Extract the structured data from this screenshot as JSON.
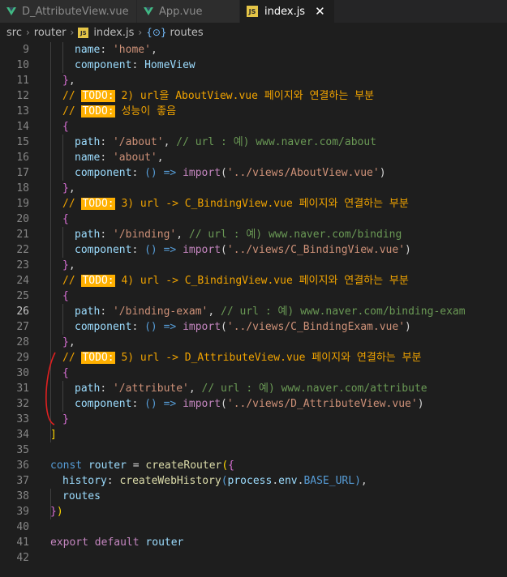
{
  "tabs": [
    {
      "label": "D_AttributeView.vue"
    },
    {
      "label": "App.vue"
    },
    {
      "label": "index.js",
      "icon_text": "JS",
      "close": "✕"
    }
  ],
  "breadcrumb": {
    "src": "src",
    "router": "router",
    "file": "index.js",
    "icon_text": "JS",
    "symbol_icon": "{⊙}",
    "symbol": "routes"
  },
  "editor": {
    "current_line": 26,
    "lines": [
      [
        [
          [
            "p",
            "name"
          ],
          [
            "w",
            ": "
          ],
          [
            "s",
            "'home'"
          ],
          [
            "w",
            ","
          ]
        ],
        2
      ],
      [
        [
          [
            "p",
            "component"
          ],
          [
            "w",
            ": "
          ],
          [
            "p",
            "HomeView"
          ]
        ],
        2
      ],
      [
        [
          [
            "pu",
            "}"
          ],
          [
            "w",
            ","
          ]
        ],
        1
      ],
      [
        [
          [
            "cm",
            "// "
          ],
          [
            "todo",
            "TODO:"
          ],
          [
            "cm",
            " 2) url을 AboutView.vue 페이지와 연결하는 부분"
          ]
        ],
        1
      ],
      [
        [
          [
            "cm",
            "// "
          ],
          [
            "todo",
            "TODO:"
          ],
          [
            "cm",
            " 성능이 좋음"
          ]
        ],
        1
      ],
      [
        [
          [
            "pu",
            "{"
          ]
        ],
        1
      ],
      [
        [
          [
            "p",
            "path"
          ],
          [
            "w",
            ": "
          ],
          [
            "s",
            "'/about'"
          ],
          [
            "w",
            ", "
          ],
          [
            "c",
            "// url : 예) www.naver.com/about"
          ]
        ],
        2
      ],
      [
        [
          [
            "p",
            "name"
          ],
          [
            "w",
            ": "
          ],
          [
            "s",
            "'about'"
          ],
          [
            "w",
            ","
          ]
        ],
        2
      ],
      [
        [
          [
            "p",
            "component"
          ],
          [
            "w",
            ": "
          ],
          [
            "k",
            "()"
          ],
          [
            "w",
            " "
          ],
          [
            "k",
            "=>"
          ],
          [
            "w",
            " "
          ],
          [
            "kw",
            "import"
          ],
          [
            "w",
            "("
          ],
          [
            "s",
            "'../views/AboutView.vue'"
          ],
          [
            "w",
            ")"
          ]
        ],
        2
      ],
      [
        [
          [
            "pu",
            "}"
          ],
          [
            "w",
            ","
          ]
        ],
        1
      ],
      [
        [
          [
            "cm",
            "// "
          ],
          [
            "todo",
            "TODO:"
          ],
          [
            "cm",
            " 3) url -> C_BindingView.vue 페이지와 연결하는 부분"
          ]
        ],
        1
      ],
      [
        [
          [
            "pu",
            "{"
          ]
        ],
        1
      ],
      [
        [
          [
            "p",
            "path"
          ],
          [
            "w",
            ": "
          ],
          [
            "s",
            "'/binding'"
          ],
          [
            "w",
            ", "
          ],
          [
            "c",
            "// url : 예) www.naver.com/binding"
          ]
        ],
        2
      ],
      [
        [
          [
            "p",
            "component"
          ],
          [
            "w",
            ": "
          ],
          [
            "k",
            "()"
          ],
          [
            "w",
            " "
          ],
          [
            "k",
            "=>"
          ],
          [
            "w",
            " "
          ],
          [
            "kw",
            "import"
          ],
          [
            "w",
            "("
          ],
          [
            "s",
            "'../views/C_BindingView.vue'"
          ],
          [
            "w",
            ")"
          ]
        ],
        2
      ],
      [
        [
          [
            "pu",
            "}"
          ],
          [
            "w",
            ","
          ]
        ],
        1
      ],
      [
        [
          [
            "cm",
            "// "
          ],
          [
            "todo",
            "TODO:"
          ],
          [
            "cm",
            " 4) url -> C_BindingView.vue 페이지와 연결하는 부분"
          ]
        ],
        1
      ],
      [
        [
          [
            "pu",
            "{"
          ]
        ],
        1
      ],
      [
        [
          [
            "p",
            "path"
          ],
          [
            "w",
            ": "
          ],
          [
            "s",
            "'/binding-exam'"
          ],
          [
            "w",
            ", "
          ],
          [
            "c",
            "// url : 예) www.naver.com/binding-exam"
          ]
        ],
        2
      ],
      [
        [
          [
            "p",
            "component"
          ],
          [
            "w",
            ": "
          ],
          [
            "k",
            "()"
          ],
          [
            "w",
            " "
          ],
          [
            "k",
            "=>"
          ],
          [
            "w",
            " "
          ],
          [
            "kw",
            "import"
          ],
          [
            "w",
            "("
          ],
          [
            "s",
            "'../views/C_BindingExam.vue'"
          ],
          [
            "w",
            ")"
          ]
        ],
        2
      ],
      [
        [
          [
            "pu",
            "}"
          ],
          [
            "w",
            ","
          ]
        ],
        1
      ],
      [
        [
          [
            "cm",
            "// "
          ],
          [
            "todo",
            "TODO:"
          ],
          [
            "cm",
            " 5) url -> D_AttributeView.vue 페이지와 연결하는 부분"
          ]
        ],
        1
      ],
      [
        [
          [
            "pu",
            "{"
          ]
        ],
        1
      ],
      [
        [
          [
            "p",
            "path"
          ],
          [
            "w",
            ": "
          ],
          [
            "s",
            "'/attribute'"
          ],
          [
            "w",
            ", "
          ],
          [
            "c",
            "// url : 예) www.naver.com/attribute"
          ]
        ],
        2
      ],
      [
        [
          [
            "p",
            "component"
          ],
          [
            "w",
            ": "
          ],
          [
            "k",
            "()"
          ],
          [
            "w",
            " "
          ],
          [
            "k",
            "=>"
          ],
          [
            "w",
            " "
          ],
          [
            "kw",
            "import"
          ],
          [
            "w",
            "("
          ],
          [
            "s",
            "'../views/D_AttributeView.vue'"
          ],
          [
            "w",
            ")"
          ]
        ],
        2
      ],
      [
        [
          [
            "pu",
            "}"
          ]
        ],
        1
      ],
      [
        [
          [
            "y",
            "]"
          ]
        ],
        0
      ],
      [
        [],
        0
      ],
      [
        [
          [
            "k",
            "const"
          ],
          [
            "w",
            " "
          ],
          [
            "p",
            "router"
          ],
          [
            "w",
            " = "
          ],
          [
            "f",
            "createRouter"
          ],
          [
            "y",
            "("
          ],
          [
            "pu",
            "{"
          ]
        ],
        0
      ],
      [
        [
          [
            "p",
            "history"
          ],
          [
            "w",
            ": "
          ],
          [
            "f",
            "createWebHistory"
          ],
          [
            "k",
            "("
          ],
          [
            "p",
            "process"
          ],
          [
            "w",
            "."
          ],
          [
            "p",
            "env"
          ],
          [
            "w",
            "."
          ],
          [
            "k",
            "BASE_URL"
          ],
          [
            "k",
            ")"
          ],
          [
            "w",
            ","
          ]
        ],
        1
      ],
      [
        [
          [
            "p",
            "routes"
          ]
        ],
        1
      ],
      [
        [
          [
            "pu",
            "}"
          ],
          [
            "y",
            ")"
          ]
        ],
        0
      ],
      [
        [],
        0
      ],
      [
        [
          [
            "kw",
            "export"
          ],
          [
            "w",
            " "
          ],
          [
            "kw",
            "default"
          ],
          [
            "w",
            " "
          ],
          [
            "p",
            "router"
          ]
        ],
        0
      ],
      [
        [],
        0
      ]
    ],
    "first_line_number": 9
  }
}
